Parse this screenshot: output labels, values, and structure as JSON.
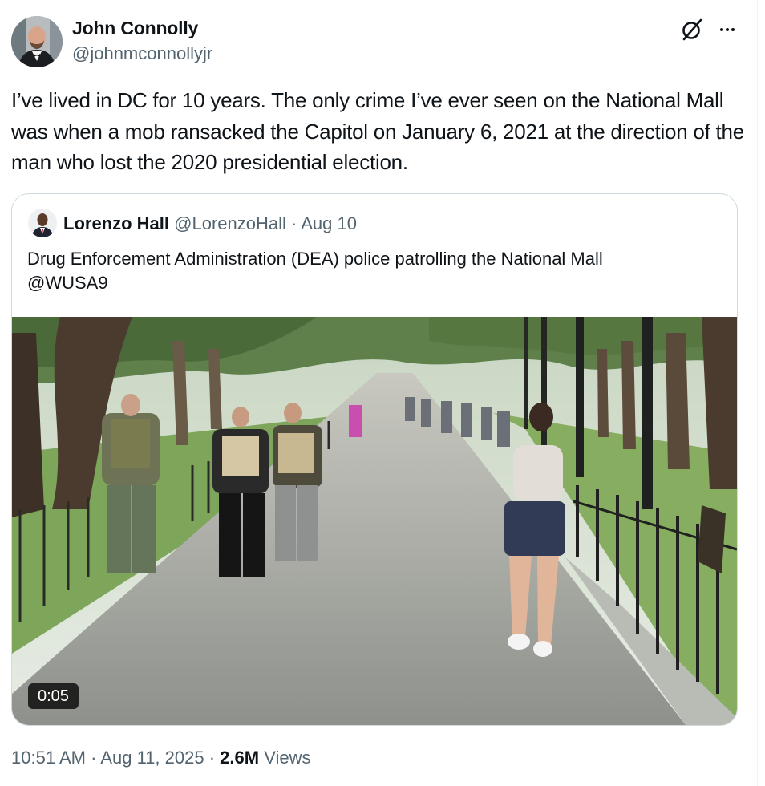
{
  "tweet": {
    "author": {
      "name": "John Connolly",
      "handle": "@johnmconnollyjr"
    },
    "icons": {
      "grok": "grok-icon",
      "more": "more-icon"
    },
    "text": "I’ve lived in DC for 10 years. The only crime I’ve ever seen on the National Mall was when a mob ransacked the Capitol on January 6, 2021 at the direction of the man who lost the 2020 presidential election.",
    "quote": {
      "author": {
        "name": "Lorenzo Hall",
        "handle": "@LorenzoHall",
        "sep": "·",
        "date": "Aug 10"
      },
      "text": "Drug Enforcement Administration (DEA) police patrolling the National Mall\n@WUSA9",
      "video": {
        "duration": "0:05"
      }
    },
    "footer": {
      "time": "10:51 AM",
      "sep1": "·",
      "date": "Aug 11, 2025",
      "sep2": "·",
      "views_count": "2.6M",
      "views_label": "Views"
    }
  }
}
